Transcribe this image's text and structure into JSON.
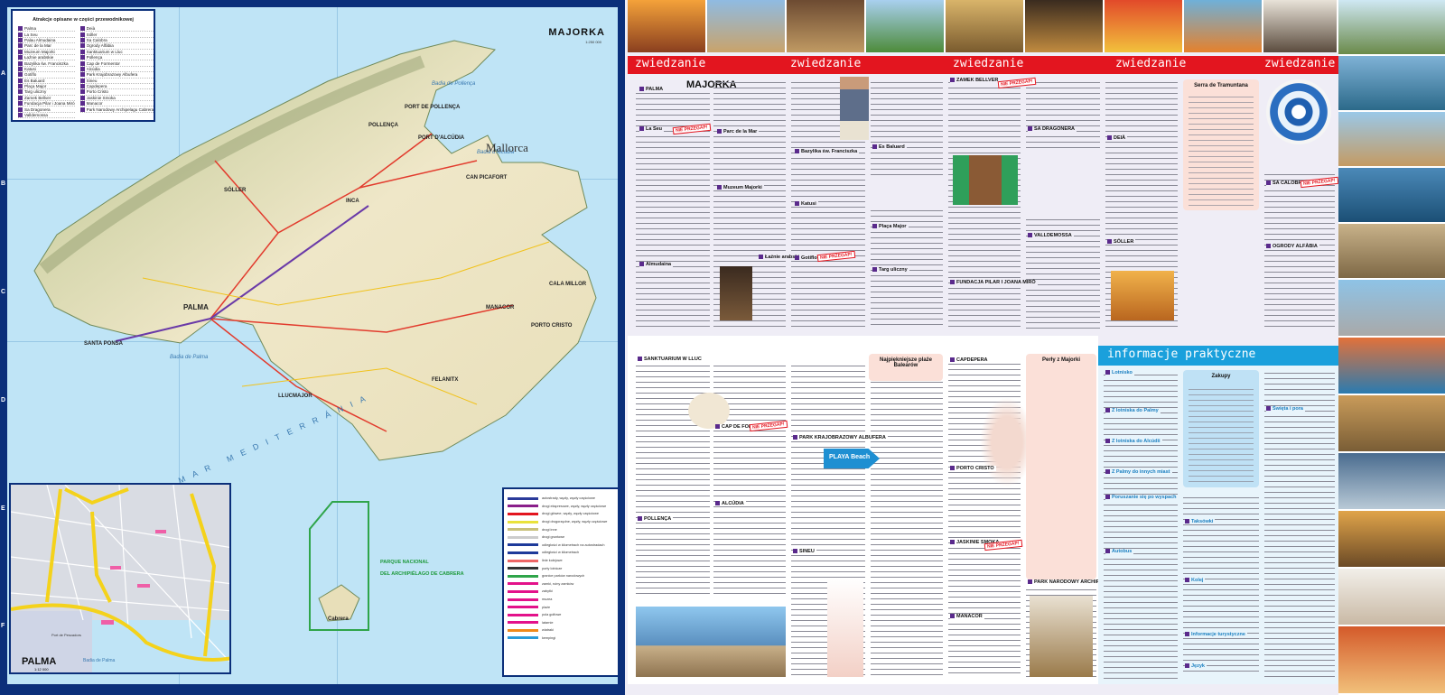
{
  "map": {
    "title": "MAJORKA",
    "scale": "1:250 000",
    "island_label": "Mallorca",
    "sea_label": "MAR MEDITERRÁNIA",
    "places": [
      "POLLENÇA",
      "PORT DE POLLENÇA",
      "PORT D'ALCÚDIA",
      "INCA",
      "CAN PICAFORT",
      "PALMA",
      "MANACOR",
      "CALA MILLOR",
      "PORTO CRISTO",
      "SÓLLER",
      "SANTA PONSA",
      "LLUCMAJOR",
      "FELANITX",
      "Badia de Palma",
      "Badia de Pollença",
      "Badia d'Alcúdia",
      "Cabrera"
    ],
    "cabrera_label": [
      "PARQUE NACIONAL",
      "DEL ARCHIPIÉLAGO DE CABRERA"
    ],
    "grid_letters": [
      "A",
      "B",
      "C",
      "D",
      "E",
      "F"
    ],
    "attractions": {
      "title": "Atrakcje opisane w części przewodnikowej",
      "left": [
        "Palma",
        "La Seu",
        "Palau Almudaina",
        "Parc de la Mar",
        "Muzeum Majorki",
        "Łaźnie arabskie",
        "Bazylika św. Franciszka",
        "Katusi",
        "Gotiflo",
        "Es Baluard",
        "Plaça Major",
        "Targ uliczny",
        "Zamek Bellver",
        "Fundacja Pilar i Joana Miró",
        "Sa Dragonera",
        "Valldemossa"
      ],
      "right": [
        "Deià",
        "Sóller",
        "Sa Calobra",
        "Ogrody Alfàbia",
        "Sanktuarium w Lluc",
        "Pollença",
        "Cap de Formentor",
        "Alcúdia",
        "Park Krajobrazowy Albufera",
        "Sineu",
        "Capdepera",
        "Porto Cristo",
        "Jaskinie Smoka",
        "Manacor",
        "Park Narodowy Archipelagu Cabrera"
      ]
    },
    "inset": {
      "title": "PALMA",
      "scale": "1:12 000",
      "labels": [
        "Port de Pescadors",
        "Badia de Palma"
      ]
    },
    "legend": [
      "autostrady, węzły, węzły częściowe",
      "drogi ekspresowe, węzły, węzły częściowe",
      "drogi główne, węzły, węzły częściowe",
      "drogi drugorzędne, węzły, węzły częściowe",
      "drogi inne",
      "drogi gruntowe",
      "odległości w kilometrach na autostradach",
      "odległości w kilometrach",
      "linie kolejowe",
      "porty lotnicze",
      "granice parków narodowych",
      "zamki, ruiny zamków",
      "zabytki",
      "muzea",
      "plaże",
      "pola golfowe",
      "latarnie",
      "wiatraki",
      "kempingi"
    ]
  },
  "guide": {
    "section_label": "zwiedzanie",
    "practical_label": "informacje praktyczne",
    "heading": "MAJORKA",
    "stamp": "NIE PRZEGAP!",
    "sections": [
      "PALMA",
      "La Seu",
      "Parc de la Mar",
      "Muzeum Majorki",
      "Łaźnie arabskie",
      "Almudaina",
      "Bazylika św. Franciszka",
      "Katusi",
      "Gotiflo",
      "Es Baluard",
      "Plaça Major",
      "Targ uliczny",
      "ZAMEK BELLVER",
      "SA DRAGONERA",
      "DEIÀ",
      "VALLDEMOSSA",
      "SÓLLER",
      "FUNDACJA PILAR I JOANA MIRÓ",
      "SA CALOBRA",
      "OGRODY ALFÀBIA",
      "SANKTUARIUM W LLUC",
      "CAP DE FORMENTOR",
      "POLLENÇA",
      "ALCÚDIA",
      "PARK KRAJOBRAZOWY ALBUFERA",
      "SINEU",
      "CAPDEPERA",
      "PORTO CRISTO",
      "JASKINIE SMOKA",
      "MANACOR",
      "PARK NARODOWY ARCHIPELAGU CABRERA"
    ],
    "boxes": {
      "tramuntana": "Serra de Tramuntana",
      "beaches": "Najpiękniejsze plaże Balearów",
      "pearls": "Perły z Majorki",
      "shopping": "Zakupy"
    },
    "practical": [
      "Lotnisko",
      "Z lotniska do Palmy",
      "Z lotniska do Alcúdii",
      "Z Palmy do innych miast",
      "Poruszanie się po wyspach",
      "Autobus",
      "Taksówki",
      "Kolej",
      "Informacje turystyczne",
      "Język",
      "Święta i pora"
    ],
    "beach_sign": "PLAYA Beach"
  }
}
